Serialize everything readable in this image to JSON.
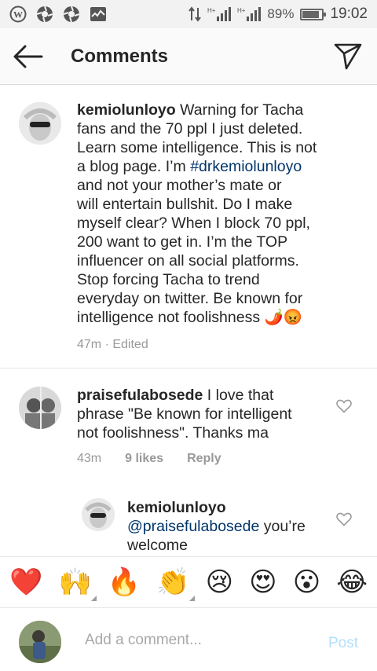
{
  "status_bar": {
    "left_icons": [
      "wordpress-icon",
      "aperture-icon",
      "aperture-icon",
      "activity-icon"
    ],
    "network": "H+",
    "battery_percent": "89%",
    "battery_level": 0.89,
    "time": "19:02"
  },
  "header": {
    "title": "Comments"
  },
  "post_comment": {
    "username": "kemiolunloyo",
    "text_before_tag": " Warning for Tacha\nfans and the 70 ppl I just deleted.\nLearn some intelligence. This is not\na blog page. I’m ",
    "hashtag": "#drkemiolunloyo",
    "text_after_tag": "\nand not your mother’s mate or\nwill entertain bullshit. Do I make\nmyself clear? When I block 70 ppl,\n200 want to get in. I’m the TOP\ninfluencer on all social platforms.\nStop forcing Tacha to trend\neveryday on twitter. Be known for\nintelligence not foolishness 🌶️😡",
    "meta": "47m · Edited"
  },
  "comment_1": {
    "username": "praisefulabosede",
    "text": " I love that\nphrase \"Be known for intelligent\nnot foolishness\". Thanks ma",
    "time": "43m",
    "likes": "9 likes",
    "reply_label": "Reply"
  },
  "reply_1": {
    "username": "kemiolunloyo",
    "mention": "@praisefulabosede",
    "text": " you’re\nwelcome"
  },
  "emoji_bar": [
    "❤️",
    "🙌",
    "🔥",
    "👏",
    "😢",
    "😍",
    "😮",
    "😂"
  ],
  "compose": {
    "placeholder": "Add a comment...",
    "post_label": "Post"
  }
}
